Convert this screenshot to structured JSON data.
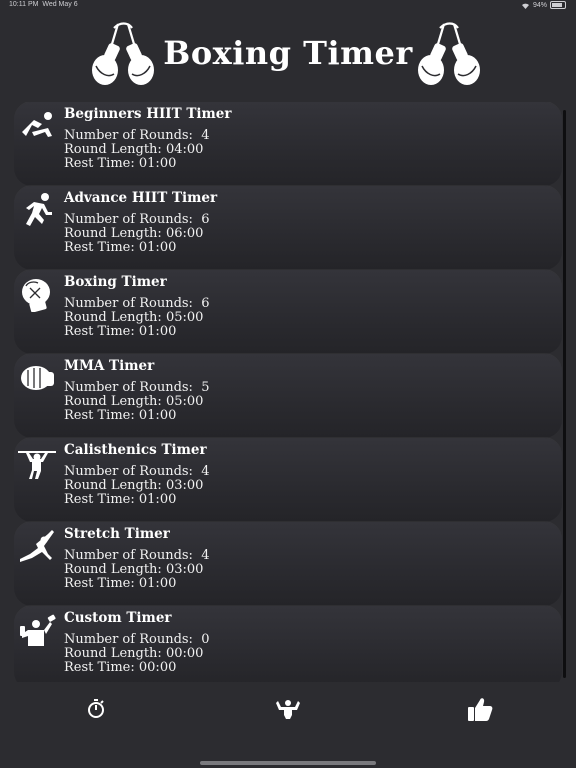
{
  "status": {
    "time": "10:11 PM",
    "date": "Wed May 6",
    "battery": "94%"
  },
  "header": {
    "title": "Boxing Timer"
  },
  "timers": [
    {
      "name": "Beginners HIIT Timer",
      "rounds_label": "Number of Rounds:",
      "rounds": "4",
      "length_label": "Round Length:",
      "length": "04:00",
      "rest_label": "Rest Time:",
      "rest": "01:00",
      "icon": "situp-icon"
    },
    {
      "name": "Advance HIIT Timer",
      "rounds_label": "Number of Rounds:",
      "rounds": "6",
      "length_label": "Round Length:",
      "length": "06:00",
      "rest_label": "Rest Time:",
      "rest": "01:00",
      "icon": "running-icon"
    },
    {
      "name": "Boxing Timer",
      "rounds_label": "Number of Rounds:",
      "rounds": "6",
      "length_label": "Round Length:",
      "length": "05:00",
      "rest_label": "Rest Time:",
      "rest": "01:00",
      "icon": "boxing-glove-icon"
    },
    {
      "name": "MMA Timer",
      "rounds_label": "Number of Rounds:",
      "rounds": "5",
      "length_label": "Round Length:",
      "length": "05:00",
      "rest_label": "Rest Time:",
      "rest": "01:00",
      "icon": "mma-glove-icon"
    },
    {
      "name": "Calisthenics Timer",
      "rounds_label": "Number of Rounds:",
      "rounds": "4",
      "length_label": "Round Length:",
      "length": "03:00",
      "rest_label": "Rest Time:",
      "rest": "01:00",
      "icon": "pullup-icon"
    },
    {
      "name": "Stretch Timer",
      "rounds_label": "Number of Rounds:",
      "rounds": "4",
      "length_label": "Round Length:",
      "length": "03:00",
      "rest_label": "Rest Time:",
      "rest": "01:00",
      "icon": "stretch-icon"
    },
    {
      "name": "Custom Timer",
      "rounds_label": "Number of Rounds:",
      "rounds": "0",
      "length_label": "Round Length:",
      "length": "00:00",
      "rest_label": "Rest Time:",
      "rest": "00:00",
      "icon": "dumbbell-icon"
    }
  ],
  "tabs": [
    {
      "icon": "stopwatch-icon"
    },
    {
      "icon": "muscle-icon"
    },
    {
      "icon": "thumbs-up-icon"
    }
  ]
}
